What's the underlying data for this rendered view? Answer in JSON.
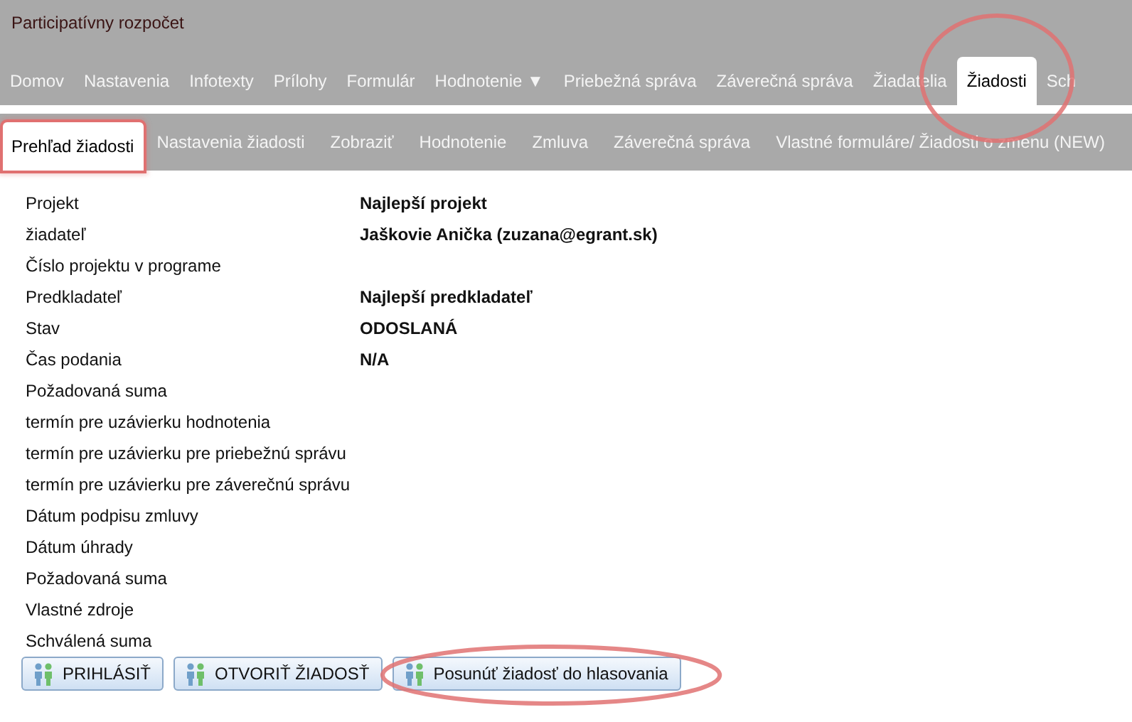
{
  "header": {
    "title": "Participatívny rozpočet"
  },
  "main_nav": [
    {
      "label": "Domov",
      "selected": false
    },
    {
      "label": "Nastavenia",
      "selected": false
    },
    {
      "label": "Infotexty",
      "selected": false
    },
    {
      "label": "Prílohy",
      "selected": false
    },
    {
      "label": "Formulár",
      "selected": false
    },
    {
      "label": "Hodnotenie ▼",
      "selected": false
    },
    {
      "label": "Priebežná správa",
      "selected": false
    },
    {
      "label": "Záverečná správa",
      "selected": false
    },
    {
      "label": "Žiadatelia",
      "selected": false
    },
    {
      "label": "Žiadosti",
      "selected": true,
      "circled": true
    },
    {
      "label": "Sch",
      "selected": false
    }
  ],
  "sub_nav": [
    {
      "label": "Prehľad žiadosti",
      "selected": true,
      "outlined": true
    },
    {
      "label": "Nastavenia žiadosti",
      "selected": false
    },
    {
      "label": "Zobraziť",
      "selected": false
    },
    {
      "label": "Hodnotenie",
      "selected": false
    },
    {
      "label": "Zmluva",
      "selected": false
    },
    {
      "label": "Záverečná správa",
      "selected": false
    },
    {
      "label": "Vlastné formuláre/ Žiadosti o zmenu (NEW)",
      "selected": false
    }
  ],
  "details": [
    {
      "label": "Projekt",
      "value": "Najlepší projekt"
    },
    {
      "label": "žiadateľ",
      "value": "Jaškovie Anička (zuzana@egrant.sk)"
    },
    {
      "label": "Číslo projektu v programe"
    },
    {
      "label": "Predkladateľ",
      "value": "Najlepší predkladateľ"
    },
    {
      "label": "Stav",
      "value": "ODOSLANÁ"
    },
    {
      "label": "Čas podania",
      "value": "N/A"
    },
    {
      "label": "Požadovaná suma"
    },
    {
      "label": "termín pre uzávierku hodnotenia"
    },
    {
      "label": "termín pre uzávierku pre priebežnú správu"
    },
    {
      "label": "termín pre uzávierku pre záverečnú správu"
    },
    {
      "label": "Dátum podpisu zmluvy"
    },
    {
      "label": "Dátum úhrady"
    },
    {
      "label": "Požadovaná suma"
    },
    {
      "label": "Vlastné zdroje"
    },
    {
      "label": "Schválená suma"
    }
  ],
  "buttons": [
    {
      "label": "PRIHLÁSIŤ"
    },
    {
      "label": "OTVORIŤ ŽIADOSŤ"
    },
    {
      "label": "Posunúť žiadosť do hlasovania",
      "circled": true
    }
  ]
}
